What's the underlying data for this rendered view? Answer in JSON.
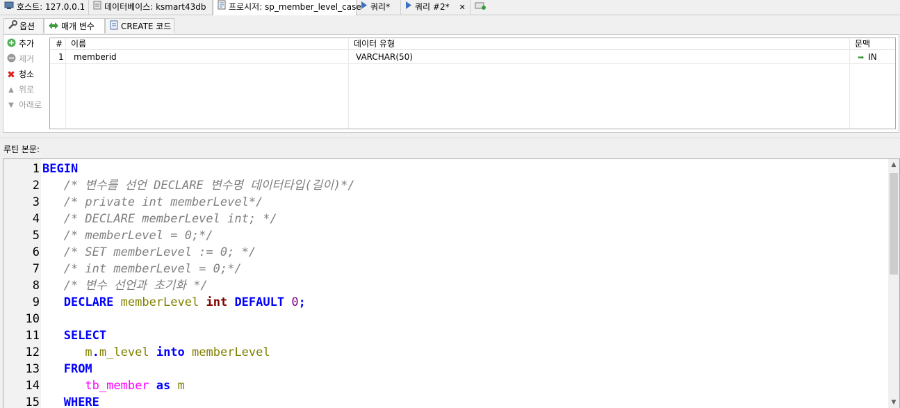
{
  "tabs": [
    {
      "label": "호스트: 127.0.0.1",
      "icon": "host-icon"
    },
    {
      "label": "데이터베이스: ksmart43db",
      "icon": "database-icon"
    },
    {
      "label": "프로시저: sp_member_level_case",
      "icon": "procedure-icon"
    },
    {
      "label": "쿼리*",
      "icon": "query-play-icon"
    },
    {
      "label": "쿼리 #2*",
      "icon": "query-play-icon"
    }
  ],
  "subtabs": [
    {
      "label": "옵션",
      "icon": "wrench-icon"
    },
    {
      "label": "매개 변수",
      "icon": "arrows-icon"
    },
    {
      "label": "CREATE 코드",
      "icon": "code-file-icon"
    }
  ],
  "side_buttons": [
    {
      "label": "추가",
      "icon": "add-icon",
      "enabled": true
    },
    {
      "label": "제거",
      "icon": "remove-icon",
      "enabled": false
    },
    {
      "label": "청소",
      "icon": "clear-icon",
      "enabled": true
    },
    {
      "label": "위로",
      "icon": "up-icon",
      "enabled": false
    },
    {
      "label": "아래로",
      "icon": "down-icon",
      "enabled": false
    }
  ],
  "params_table": {
    "columns": [
      "#",
      "이름",
      "데이터 유형",
      "문맥"
    ],
    "rows": [
      {
        "num": "1",
        "name": "memberid",
        "type": "VARCHAR(50)",
        "context": "IN"
      }
    ]
  },
  "body_label": "루틴 본문:",
  "code_lines": [
    {
      "n": "1",
      "tokens": [
        [
          "kw",
          "BEGIN"
        ]
      ]
    },
    {
      "n": "2",
      "tokens": [
        [
          "",
          "   "
        ],
        [
          "cm",
          "/* 변수를 선언 DECLARE 변수명 데이터타입(길이)*/"
        ]
      ]
    },
    {
      "n": "3",
      "tokens": [
        [
          "",
          "   "
        ],
        [
          "cm",
          "/* private int memberLevel*/"
        ]
      ]
    },
    {
      "n": "4",
      "tokens": [
        [
          "",
          "   "
        ],
        [
          "cm",
          "/* DECLARE memberLevel int; */"
        ]
      ]
    },
    {
      "n": "5",
      "tokens": [
        [
          "",
          "   "
        ],
        [
          "cm",
          "/* memberLevel = 0;*/"
        ]
      ]
    },
    {
      "n": "6",
      "tokens": [
        [
          "",
          "   "
        ],
        [
          "cm",
          "/* SET memberLevel := 0; */"
        ]
      ]
    },
    {
      "n": "7",
      "tokens": [
        [
          "",
          "   "
        ],
        [
          "cm",
          "/* int memberLevel = 0;*/"
        ]
      ]
    },
    {
      "n": "8",
      "tokens": [
        [
          "",
          "   "
        ],
        [
          "cm",
          "/* 변수 선언과 초기화 */"
        ]
      ]
    },
    {
      "n": "9",
      "tokens": [
        [
          "",
          "   "
        ],
        [
          "kw",
          "DECLARE"
        ],
        [
          "",
          " "
        ],
        [
          "id",
          "memberLevel"
        ],
        [
          "",
          " "
        ],
        [
          "ty",
          "int"
        ],
        [
          "",
          " "
        ],
        [
          "kw",
          "DEFAULT"
        ],
        [
          "",
          " "
        ],
        [
          "num",
          "0"
        ],
        [
          "kw",
          ";"
        ]
      ]
    },
    {
      "n": "10",
      "tokens": []
    },
    {
      "n": "11",
      "tokens": [
        [
          "",
          "   "
        ],
        [
          "kw",
          "SELECT"
        ]
      ]
    },
    {
      "n": "12",
      "tokens": [
        [
          "",
          "      "
        ],
        [
          "id",
          "m"
        ],
        [
          "kw",
          "."
        ],
        [
          "id",
          "m_level"
        ],
        [
          "",
          " "
        ],
        [
          "kw",
          "into"
        ],
        [
          "",
          " "
        ],
        [
          "id",
          "memberLevel"
        ]
      ]
    },
    {
      "n": "13",
      "tokens": [
        [
          "",
          "   "
        ],
        [
          "kw",
          "FROM"
        ]
      ]
    },
    {
      "n": "14",
      "tokens": [
        [
          "",
          "      "
        ],
        [
          "tb",
          "tb_member"
        ],
        [
          "",
          " "
        ],
        [
          "kw",
          "as"
        ],
        [
          "",
          " "
        ],
        [
          "id",
          "m"
        ]
      ]
    },
    {
      "n": "15",
      "tokens": [
        [
          "",
          "   "
        ],
        [
          "kw",
          "WHERE"
        ]
      ]
    }
  ]
}
